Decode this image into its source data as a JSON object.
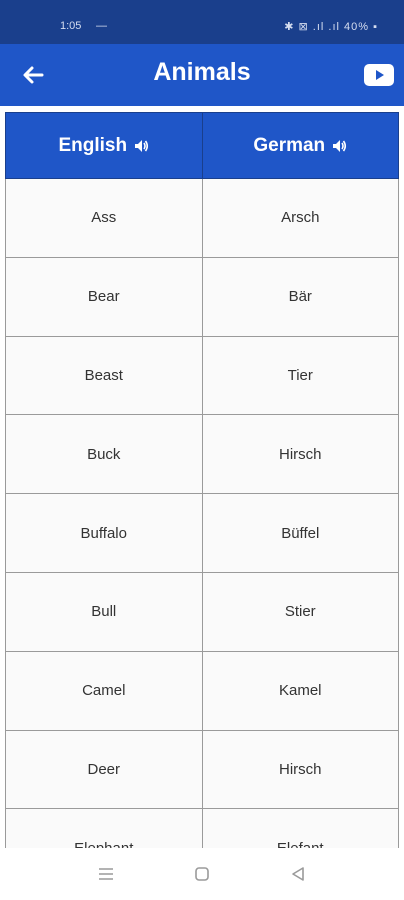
{
  "status_bar": {
    "time": "1:05",
    "dash": "—",
    "right": "✱ ⊠ .ıl .ıl 40% ▪"
  },
  "app_bar": {
    "title": "Animals",
    "back_icon": "arrow-left-icon",
    "video_icon": "youtube-icon"
  },
  "table": {
    "headers": [
      {
        "label": "English",
        "icon": "speaker-icon"
      },
      {
        "label": "German",
        "icon": "speaker-icon"
      }
    ],
    "rows": [
      {
        "english": "Ass",
        "german": "Arsch"
      },
      {
        "english": "Bear",
        "german": "Bär"
      },
      {
        "english": "Beast",
        "german": "Tier"
      },
      {
        "english": "Buck",
        "german": "Hirsch"
      },
      {
        "english": "Buffalo",
        "german": "Büffel"
      },
      {
        "english": "Bull",
        "german": "Stier"
      },
      {
        "english": "Camel",
        "german": "Kamel"
      },
      {
        "english": "Deer",
        "german": "Hirsch"
      },
      {
        "english": "Elephant",
        "german": "Elefant"
      }
    ]
  },
  "nav_bar": {
    "icons": [
      "menu-icon",
      "home-square-icon",
      "back-triangle-icon"
    ]
  },
  "colors": {
    "status_bar": "#1a3f8c",
    "app_bar": "#1f56c8",
    "cell_bg": "#fafafa",
    "cell_border": "#9a9a9a"
  }
}
